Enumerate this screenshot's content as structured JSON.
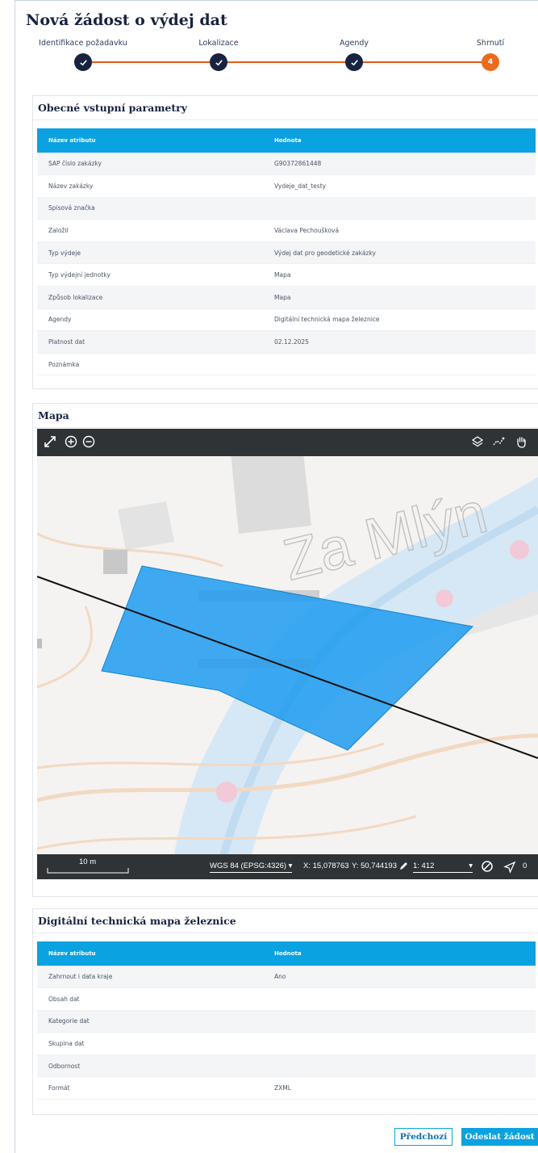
{
  "page": {
    "title": "Nová žádost o výdej dat"
  },
  "stepper": {
    "steps": [
      {
        "label": "Identifikace požadavku",
        "state": "done"
      },
      {
        "label": "Lokalizace",
        "state": "done"
      },
      {
        "label": "Agendy",
        "state": "done"
      },
      {
        "label": "Shrnutí",
        "state": "active",
        "number": "4"
      }
    ]
  },
  "general": {
    "title": "Obecné vstupní parametry",
    "col_attr": "Název atributu",
    "col_value": "Hodnota",
    "rows": [
      {
        "attr": "SAP číslo zakázky",
        "value": "G90372861448"
      },
      {
        "attr": "Název zakázky",
        "value": "Vydeje_dat_testy"
      },
      {
        "attr": "Spisová značka",
        "value": ""
      },
      {
        "attr": "Založil",
        "value": "Václava Pechoušková"
      },
      {
        "attr": "Typ výdeje",
        "value": "Výdej dat pro geodetické zakázky"
      },
      {
        "attr": "Typ výdejní jednotky",
        "value": "Mapa"
      },
      {
        "attr": "Způsob lokalizace",
        "value": "Mapa"
      },
      {
        "attr": "Agendy",
        "value": "Digitální technická mapa železnice"
      },
      {
        "attr": "Platnost dat",
        "value": "02.12.2025"
      },
      {
        "attr": "Poznámka",
        "value": ""
      }
    ]
  },
  "map": {
    "title": "Mapa",
    "street_label": "Za Mlýn",
    "scale_bar": "10 m",
    "crs": "WGS 84 (EPSG:4326)",
    "coord_x": "X: 15,078763",
    "coord_y": "Y: 50,744193",
    "scale": "1: 412",
    "rotation": "0",
    "colors": {
      "polygon": "#1d9bf0",
      "toolbar": "#2f3336"
    }
  },
  "dtm": {
    "title": "Digitální technická mapa železnice",
    "col_attr": "Název atributu",
    "col_value": "Hodnota",
    "rows": [
      {
        "attr": "Zahrnout i data kraje",
        "value": "Ano"
      },
      {
        "attr": "Obsah dat",
        "value": ""
      },
      {
        "attr": "Kategorie dat",
        "value": ""
      },
      {
        "attr": "Skupina dat",
        "value": ""
      },
      {
        "attr": "Odbornost",
        "value": ""
      },
      {
        "attr": "Formát",
        "value": "ZXML"
      }
    ]
  },
  "actions": {
    "prev": "Předchozí",
    "send": "Odeslat žádost"
  },
  "colors": {
    "accent": "#0aa2e0",
    "step_done": "#17233f",
    "step_active": "#ee6a1c"
  }
}
